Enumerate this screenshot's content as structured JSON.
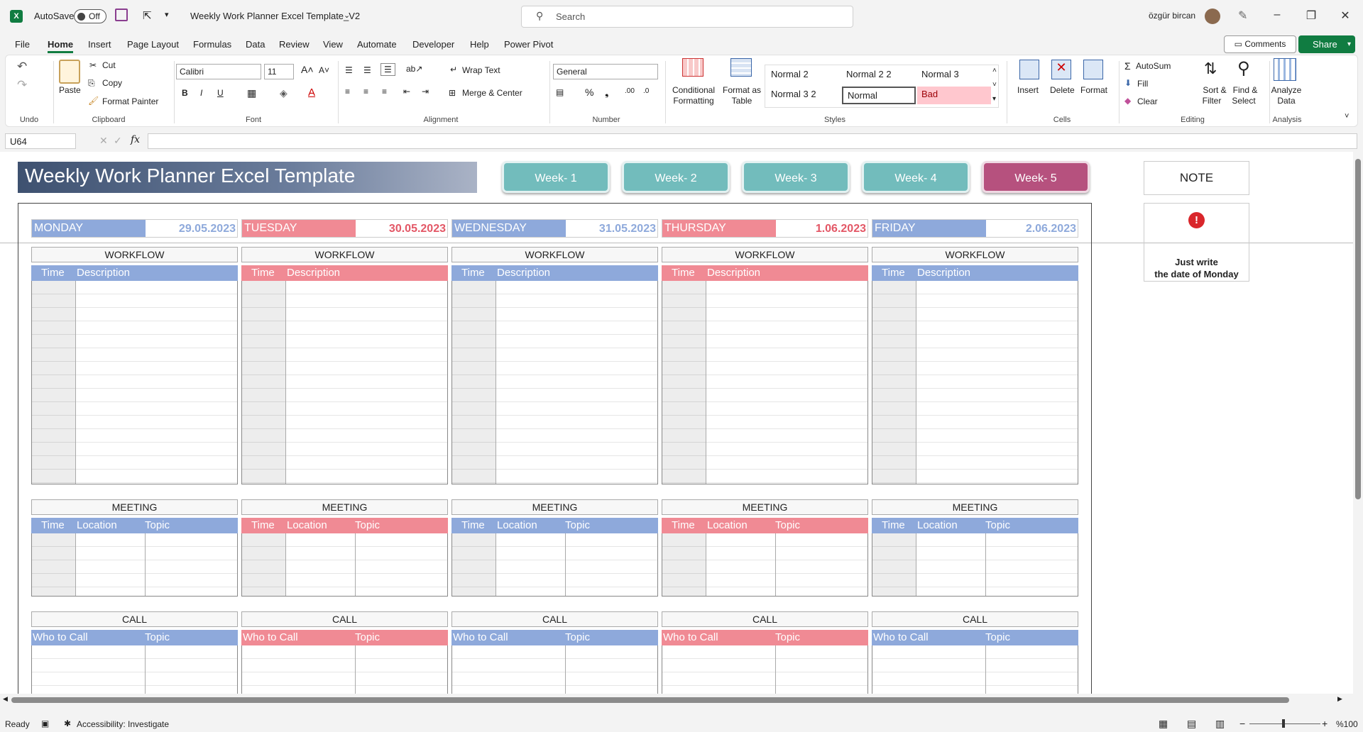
{
  "titlebar": {
    "autosave_label": "AutoSave",
    "autosave_state": "Off",
    "file_name": "Weekly Work Planner Excel Template_V2",
    "search_placeholder": "Search",
    "user_name": "özgür bircan"
  },
  "menu": [
    "File",
    "Home",
    "Insert",
    "Page Layout",
    "Formulas",
    "Data",
    "Review",
    "View",
    "Automate",
    "Developer",
    "Help",
    "Power Pivot"
  ],
  "menu_active": "Home",
  "actions": {
    "comments": "Comments",
    "share": "Share"
  },
  "ribbon": {
    "undo_group": "Undo",
    "paste": "Paste",
    "cut": "Cut",
    "copy": "Copy",
    "format_painter": "Format Painter",
    "clipboard_group": "Clipboard",
    "font_name": "Calibri",
    "font_size": "11",
    "bold": "B",
    "italic": "I",
    "underline": "U",
    "font_group": "Font",
    "wrap_text": "Wrap Text",
    "merge_center": "Merge & Center",
    "alignment_group": "Alignment",
    "number_format": "General",
    "number_group": "Number",
    "conditional_formatting_1": "Conditional",
    "conditional_formatting_2": "Formatting",
    "format_as_table_1": "Format as",
    "format_as_table_2": "Table",
    "styles": [
      "Normal 2",
      "Normal 2 2",
      "Normal 3",
      "Normal 3 2",
      "Normal",
      "Bad"
    ],
    "styles_group": "Styles",
    "insert": "Insert",
    "delete": "Delete",
    "format": "Format",
    "cells_group": "Cells",
    "autosum": "AutoSum",
    "fill": "Fill",
    "clear": "Clear",
    "sort_filter_1": "Sort &",
    "sort_filter_2": "Filter",
    "find_select_1": "Find &",
    "find_select_2": "Select",
    "editing_group": "Editing",
    "analyze_1": "Analyze",
    "analyze_2": "Data",
    "analysis_group": "Analysis"
  },
  "formula_bar": {
    "name_box": "U64",
    "fx": "fx",
    "formula": ""
  },
  "planner": {
    "title": "Weekly Work Planner Excel Template",
    "weeks": [
      "Week- 1",
      "Week- 2",
      "Week- 3",
      "Week- 4",
      "Week- 5"
    ],
    "active_week": "Week- 5",
    "note_title": "NOTE",
    "note_text_1": "Just write",
    "note_text_2": "the date of Monday",
    "days": [
      {
        "name": "MONDAY",
        "date": "29.05.2023",
        "theme": "blue"
      },
      {
        "name": "TUESDAY",
        "date": "30.05.2023",
        "theme": "red"
      },
      {
        "name": "WEDNESDAY",
        "date": "31.05.2023",
        "theme": "blue"
      },
      {
        "name": "THURSDAY",
        "date": "1.06.2023",
        "theme": "red"
      },
      {
        "name": "FRIDAY",
        "date": "2.06.2023",
        "theme": "blue"
      }
    ],
    "workflow": {
      "title": "WORKFLOW",
      "cols": [
        "Time",
        "Description"
      ]
    },
    "meeting": {
      "title": "MEETING",
      "cols": [
        "Time",
        "Location",
        "Topic"
      ]
    },
    "call": {
      "title": "CALL",
      "cols": [
        "Who to Call",
        "Topic"
      ]
    }
  },
  "status": {
    "ready": "Ready",
    "accessibility": "Accessibility: Investigate",
    "zoom": "%100"
  },
  "colors": {
    "excel_green": "#107c41",
    "blue": "#8ea9db",
    "red": "#f08a94",
    "week_teal": "#72bcbc",
    "week_magenta": "#b6517e"
  }
}
